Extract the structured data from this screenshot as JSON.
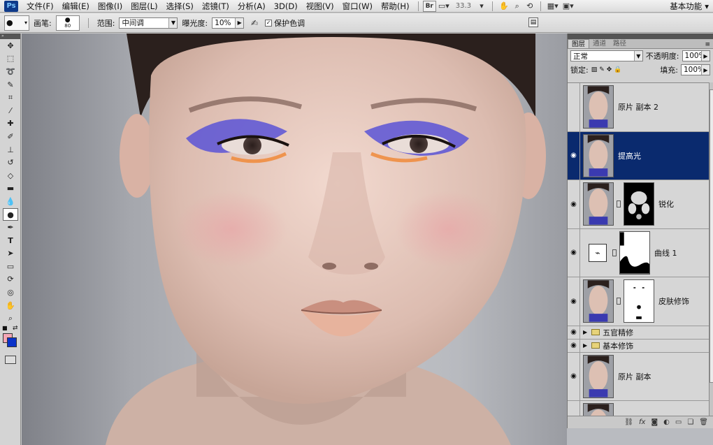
{
  "app": {
    "logo": "Ps"
  },
  "menu": [
    "文件(F)",
    "编辑(E)",
    "图像(I)",
    "图层(L)",
    "选择(S)",
    "滤镜(T)",
    "分析(A)",
    "3D(D)",
    "视图(V)",
    "窗口(W)",
    "帮助(H)"
  ],
  "menubar_tools": {
    "bridge_label": "Br",
    "zoom_readout": "33.3",
    "workspace_label": "基本功能"
  },
  "options": {
    "brush_label": "画笔:",
    "brush_size": "80",
    "range_label": "范围:",
    "range_value": "中间调",
    "exposure_label": "曝光度:",
    "exposure_value": "10%",
    "protect_tones_label": "保护色调",
    "protect_tones_checked": true
  },
  "toolbox": {
    "tools": [
      "move-icon",
      "marquee-icon",
      "lasso-icon",
      "quick-select-icon",
      "crop-icon",
      "eyedropper-icon",
      "healing-icon",
      "brush-icon",
      "stamp-icon",
      "history-brush-icon",
      "eraser-icon",
      "gradient-icon",
      "blur-icon",
      "dodge-icon",
      "pen-icon",
      "type-icon",
      "path-select-icon",
      "shape-icon",
      "3d-rotate-icon",
      "3d-orbit-icon",
      "hand-icon",
      "zoom-icon"
    ],
    "active_tool_index": 13,
    "foreground_color": "#f4a6b6",
    "background_color": "#0a32c8"
  },
  "layers_panel": {
    "tabs": [
      "图层",
      "通道",
      "路径"
    ],
    "active_tab": 0,
    "blend_mode": "正常",
    "opacity_label": "不透明度:",
    "opacity_value": "100%",
    "lock_label": "锁定:",
    "fill_label": "填充:",
    "fill_value": "100%",
    "layers": [
      {
        "name": "原片 副本 2",
        "visible": false,
        "selected": false,
        "type": "image"
      },
      {
        "name": "提高光",
        "visible": true,
        "selected": true,
        "type": "image"
      },
      {
        "name": "锐化",
        "visible": true,
        "selected": false,
        "type": "image-mask"
      },
      {
        "name": "曲线 1",
        "visible": true,
        "selected": false,
        "type": "adjustment-mask"
      },
      {
        "name": "皮肤修饰",
        "visible": true,
        "selected": false,
        "type": "image-mask"
      },
      {
        "name": "五官精修",
        "visible": true,
        "selected": false,
        "type": "group"
      },
      {
        "name": "基本修饰",
        "visible": true,
        "selected": false,
        "type": "group"
      },
      {
        "name": "原片 副本",
        "visible": true,
        "selected": false,
        "type": "image"
      },
      {
        "name": "",
        "visible": true,
        "selected": false,
        "type": "image"
      }
    ],
    "footer_icons": [
      "link-icon",
      "fx-icon",
      "mask-icon",
      "adjustment-icon",
      "group-icon",
      "new-layer-icon",
      "trash-icon"
    ]
  }
}
